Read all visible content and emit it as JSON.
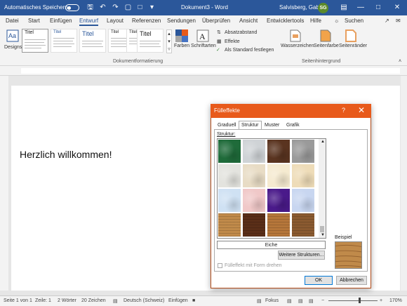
{
  "titlebar": {
    "autosave_label": "Automatisches Speichern",
    "document_title": "Dokument3 - Word",
    "user_name": "Salvisberg, Gaby",
    "user_initials": "SG"
  },
  "tabs": [
    "Datei",
    "Start",
    "Einfügen",
    "Entwurf",
    "Layout",
    "Referenzen",
    "Sendungen",
    "Überprüfen",
    "Ansicht",
    "Entwicklertools",
    "Hilfe"
  ],
  "active_tab": "Entwurf",
  "search_label": "Suchen",
  "ribbon": {
    "designs_label": "Designs",
    "gallery_titles": [
      "Titel",
      "Titel",
      "Titel",
      "Titel",
      "Titel",
      "Titel"
    ],
    "colors_label": "Farben",
    "fonts_label": "Schriftarten",
    "paragraph_spacing_label": "Absatzabstand",
    "effects_label": "Effekte",
    "set_default_label": "Als Standard festlegen",
    "group_document_formatting": "Dokumentformatierung",
    "watermark_label": "Wasserzeichen",
    "page_color_label": "Seitenfarbe",
    "page_borders_label": "Seitenränder",
    "group_page_background": "Seitenhintergrund"
  },
  "document": {
    "heading": "Herzlich willkommen!"
  },
  "statusbar": {
    "page": "Seite 1 von 1",
    "line": "Zeile: 1",
    "words": "2 Wörter",
    "chars": "20 Zeichen",
    "language": "Deutsch (Schweiz)",
    "insert_mode": "Einfügen",
    "focus_label": "Fokus",
    "zoom": "170%"
  },
  "dialog": {
    "title": "Fülleffekte",
    "help": "?",
    "close": "✕",
    "tabs": [
      "Graduell",
      "Struktur",
      "Muster",
      "Grafik"
    ],
    "active_tab": "Struktur",
    "section_label": "Struktur:",
    "textures": [
      {
        "name": "green-marble",
        "color": "#1f6b3a"
      },
      {
        "name": "white-marble",
        "color": "#cfd3d6"
      },
      {
        "name": "brown-marble",
        "color": "#5a3420"
      },
      {
        "name": "granite",
        "color": "#9a9a9a"
      },
      {
        "name": "parchment-gray",
        "color": "#e3e3de"
      },
      {
        "name": "sand",
        "color": "#e8dcc5"
      },
      {
        "name": "cream",
        "color": "#f5ead0"
      },
      {
        "name": "stationery",
        "color": "#eedcb8"
      },
      {
        "name": "blue-tissue",
        "color": "#cfe1f3"
      },
      {
        "name": "pink-tissue",
        "color": "#f0c8c8"
      },
      {
        "name": "purple-mesh",
        "color": "#4a1a8a"
      },
      {
        "name": "bouquet",
        "color": "#c8d6f0"
      },
      {
        "name": "cork",
        "color": "#c08a4a"
      },
      {
        "name": "walnut",
        "color": "#5a2e18"
      },
      {
        "name": "oak",
        "color": "#b5763a"
      },
      {
        "name": "medium-wood",
        "color": "#8a5a30"
      }
    ],
    "selected_texture_name": "Eiche",
    "more_textures_label": "Weitere Strukturen...",
    "rotate_label": "Fülleffekt mit Form drehen",
    "sample_label": "Beispiel",
    "sample_color": "#c08a4a",
    "ok_label": "OK",
    "cancel_label": "Abbrechen"
  },
  "colors": {
    "word_blue": "#2b579a",
    "dialog_orange": "#e85a1b"
  }
}
